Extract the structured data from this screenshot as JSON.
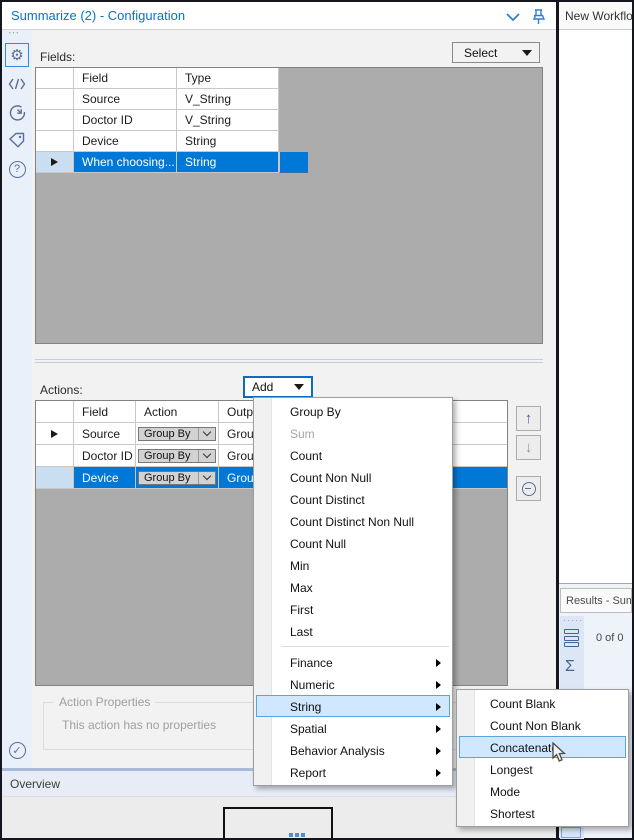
{
  "title_bar": {
    "title": "Summarize (2) - Configuration"
  },
  "fields_section": {
    "label": "Fields:",
    "select_button_label": "Select",
    "columns": {
      "field": "Field",
      "type": "Type"
    },
    "rows": [
      {
        "field": "Source",
        "type": "V_String"
      },
      {
        "field": "Doctor ID",
        "type": "V_String"
      },
      {
        "field": "Device",
        "type": "String"
      },
      {
        "field": "When choosing...",
        "type": "String"
      }
    ]
  },
  "actions_section": {
    "label": "Actions:",
    "add_button_label": "Add",
    "columns": {
      "field": "Field",
      "action": "Action",
      "output": "Output Field Name"
    },
    "rows": [
      {
        "field": "Source",
        "action": "Group By",
        "output": "Group By"
      },
      {
        "field": "Doctor ID",
        "action": "Group By",
        "output": "Group By"
      },
      {
        "field": "Device",
        "action": "Group By",
        "output": "Group By"
      }
    ]
  },
  "action_properties": {
    "title": "Action Properties",
    "message": "This action has no properties"
  },
  "add_menu": {
    "items": [
      {
        "label": "Group By"
      },
      {
        "label": "Sum"
      },
      {
        "label": "Count"
      },
      {
        "label": "Count Non Null"
      },
      {
        "label": "Count Distinct"
      },
      {
        "label": "Count Distinct Non Null"
      },
      {
        "label": "Count Null"
      },
      {
        "label": "Min"
      },
      {
        "label": "Max"
      },
      {
        "label": "First"
      },
      {
        "label": "Last"
      },
      {
        "label": "Finance"
      },
      {
        "label": "Numeric"
      },
      {
        "label": "String"
      },
      {
        "label": "Spatial"
      },
      {
        "label": "Behavior Analysis"
      },
      {
        "label": "Report"
      }
    ]
  },
  "string_submenu": {
    "items": [
      {
        "label": "Count Blank"
      },
      {
        "label": "Count Non Blank"
      },
      {
        "label": "Concatenate"
      },
      {
        "label": "Longest"
      },
      {
        "label": "Mode"
      },
      {
        "label": "Shortest"
      }
    ]
  },
  "overview": {
    "label": "Overview"
  },
  "right_panel": {
    "workflow_tab": "New Workflo",
    "results_caption": "Results - Sum",
    "record_count": "0 of 0"
  },
  "colors": {
    "accent_blue": "#0079c1",
    "selection_blue": "#0078d7",
    "menu_highlight": "#cfe8ff",
    "grid_background": "#acacac"
  }
}
